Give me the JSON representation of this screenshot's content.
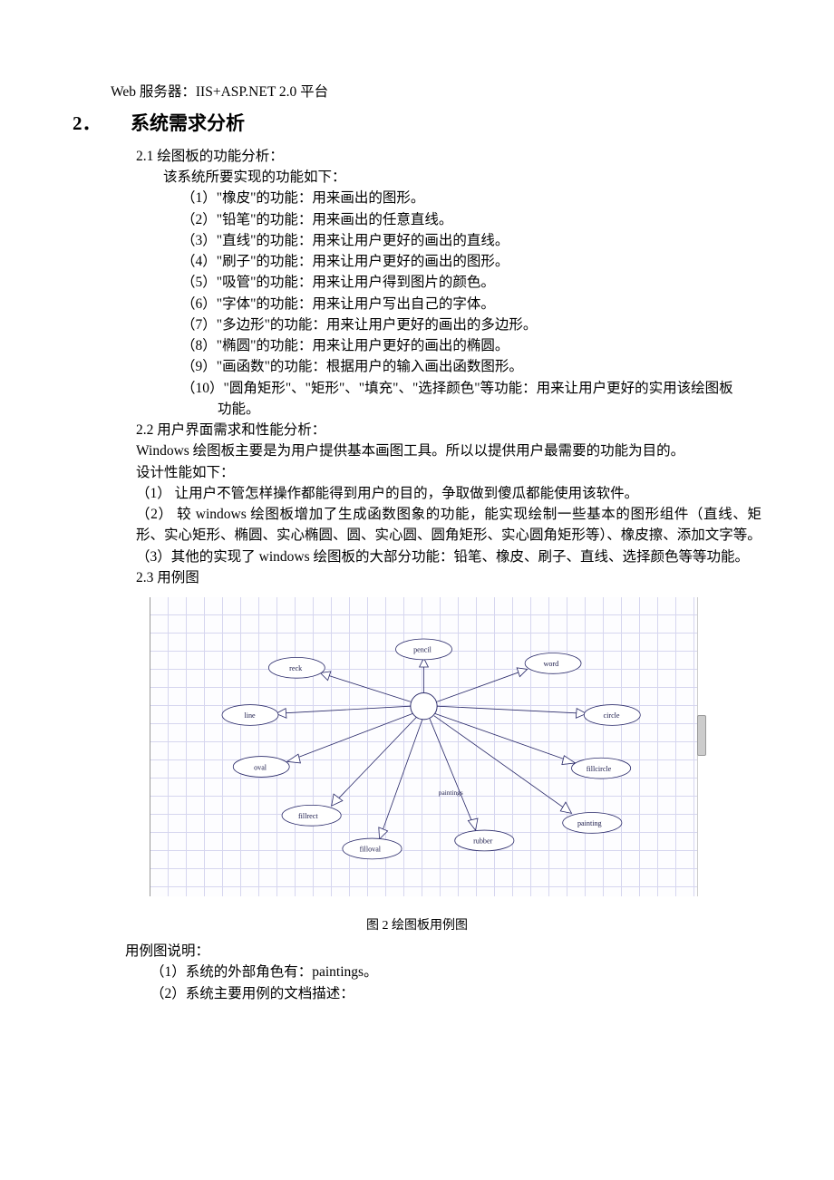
{
  "top_line": "Web 服务器：IIS+ASP.NET 2.0 平台",
  "h2": {
    "num": "2．",
    "text": "系统需求分析"
  },
  "s21_title": "2.1 绘图板的功能分析：",
  "s21_intro": "该系统所要实现的功能如下：",
  "s21_items": [
    "（1）\"橡皮\"的功能：用来画出的图形。",
    "（2）\"铅笔\"的功能：用来画出的任意直线。",
    "（3）\"直线\"的功能：用来让用户更好的画出的直线。",
    "（4）\"刷子\"的功能：用来让用户更好的画出的图形。",
    "（5）\"吸管\"的功能：用来让用户得到图片的颜色。",
    "（6）\"字体\"的功能：用来让用户写出自己的字体。",
    "（7）\"多边形\"的功能：用来让用户更好的画出的多边形。",
    "（8）\"椭圆\"的功能：用来让用户更好的画出的椭圆。",
    "（9）\"画函数\"的功能：根据用户的输入画出函数图形。"
  ],
  "s21_item10_a": "（10）\"圆角矩形\"、\"矩形\"、\"填充\"、\"选择颜色\"等功能：用来让用户更好的实用该绘图板",
  "s21_item10_b": "功能。",
  "s22_title": "2.2 用户界面需求和性能分析：",
  "s22_p1": "Windows 绘图板主要是为用户提供基本画图工具。所以以提供用户最需要的功能为目的。",
  "s22_p2": "设计性能如下：",
  "s22_p3": "（1） 让用户不管怎样操作都能得到用户的目的，争取做到傻瓜都能使用该软件。",
  "s22_p4": "（2） 较 windows 绘图板增加了生成函数图象的功能，能实现绘制一些基本的图形组件（直线、矩形、实心矩形、椭圆、实心椭圆、圆、实心圆、圆角矩形、实心圆角矩形等）、橡皮擦、添加文字等。",
  "s22_p5": "（3）其他的实现了 windows 绘图板的大部分功能：铅笔、橡皮、刷子、直线、选择颜色等等功能。",
  "s23_title": "2.3  用例图",
  "caption": "图 2  绘图板用例图",
  "desc_title": "用例图说明：",
  "desc_1": "（1）系统的外部角色有：paintings。",
  "desc_2": "（2）系统主要用例的文档描述：",
  "usecases": {
    "actor": "paintings",
    "nodes": [
      "pencil",
      "reck",
      "word",
      "line",
      "circle",
      "oval",
      "fillcircle",
      "fillrect",
      "rubber",
      "filloval",
      "painting"
    ]
  }
}
